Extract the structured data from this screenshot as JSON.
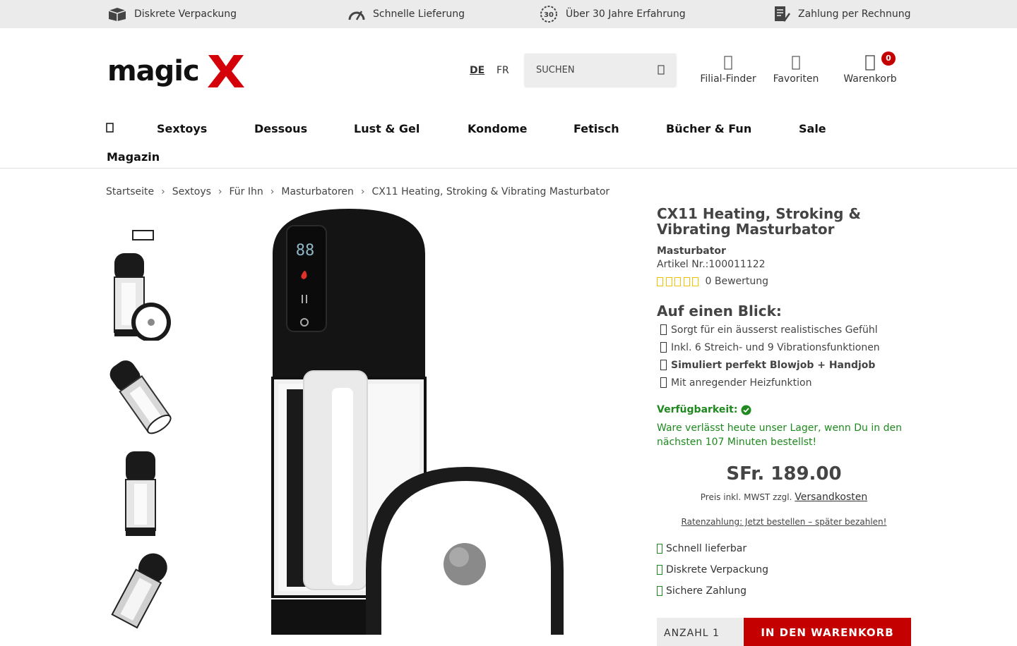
{
  "topbar": {
    "items": [
      {
        "label": "Diskrete Verpackung",
        "icon": "package-icon"
      },
      {
        "label": "Schnelle Lieferung",
        "icon": "speedometer-icon"
      },
      {
        "label": "Über 30 Jahre Erfahrung",
        "icon": "laurel-30-icon"
      },
      {
        "label": "Zahlung per Rechnung",
        "icon": "invoice-icon"
      }
    ]
  },
  "header": {
    "logo_text": "magic X",
    "languages": [
      "DE",
      "FR"
    ],
    "active_language": "DE",
    "search_placeholder": "SUCHEN",
    "actions": [
      {
        "label": "Filial-Finder",
        "icon": "location-icon"
      },
      {
        "label": "Favoriten",
        "icon": "heart-icon"
      },
      {
        "label": "Warenkorb",
        "icon": "cart-icon"
      }
    ],
    "cart_count": "0"
  },
  "nav": {
    "items": [
      "Sextoys",
      "Dessous",
      "Lust & Gel",
      "Kondome",
      "Fetisch",
      "Bücher & Fun",
      "Sale",
      "Magazin"
    ]
  },
  "breadcrumb": [
    "Startseite",
    "Sextoys",
    "Für Ihn",
    "Masturbatoren",
    "CX11 Heating, Stroking & Vibrating Masturbator"
  ],
  "product": {
    "title": "CX11 Heating, Stroking & Vibrating Masturbator",
    "category": "Masturbator",
    "article_number": "Artikel Nr.:100011122",
    "rating_text": "0 Bewertung",
    "rating_value": 0,
    "glance_title": "Auf einen Blick:",
    "glance_items": [
      {
        "text": "Sorgt für ein äusserst realistisches Gefühl",
        "bold": false
      },
      {
        "text": "Inkl. 6 Streich- und 9 Vibrationsfunktionen",
        "bold": false
      },
      {
        "text": "Simuliert perfekt Blowjob + Handjob",
        "bold": true
      },
      {
        "text": "Mit anregender Heizfunktion",
        "bold": false
      }
    ],
    "availability_label": "Verfügbarkeit:",
    "shipping_note": "Ware verlässt heute unser Lager, wenn Du in den nächsten 107 Minuten bestellst!",
    "price": "SFr. 189.00",
    "price_note": "Preis inkl. MWST zzgl.",
    "shipping_link": "Versandkosten",
    "installment_link": "Ratenzahlung: Jetzt bestellen – später bezahlen!",
    "benefits": [
      "Schnell lieferbar",
      "Diskrete Verpackung",
      "Sichere Zahlung"
    ],
    "quantity_label": "ANZAHL 1",
    "add_to_cart_label": "IN DEN WARENKORB"
  },
  "colors": {
    "brand_red": "#c40000",
    "success_green": "#1e8a1e",
    "topbar_bg": "#ebebeb"
  }
}
